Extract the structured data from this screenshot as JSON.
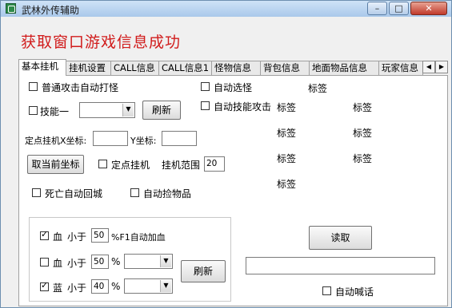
{
  "window": {
    "title": "武林外传辅助",
    "minimize": "–",
    "maximize": "□",
    "close": "✕"
  },
  "heading": "获取窗口游戏信息成功",
  "tabs": [
    "基本挂机",
    "挂机设置",
    "CALL信息",
    "CALL信息1",
    "怪物信息",
    "背包信息",
    "地面物品信息",
    "玩家信息"
  ],
  "tab_scroll": {
    "left": "◀",
    "right": "▶"
  },
  "basic": {
    "auto_attack": "普通攻击自动打怪",
    "auto_select": "自动选怪",
    "skill1": "技能一",
    "auto_skill": "自动技能攻击",
    "refresh1": "刷新",
    "fixed_x_label": "定点挂机X坐标:",
    "fixed_y_label": "Y坐标:",
    "get_coord": "取当前坐标",
    "fixed_hang": "定点挂机",
    "range_label": "挂机范围",
    "range_value": "20",
    "death_return": "死亡自动回城",
    "auto_pickup": "自动捡物品",
    "labels": [
      "标签",
      "标签",
      "标签",
      "标签",
      "标签",
      "标签",
      "标签",
      "标签"
    ]
  },
  "potion": {
    "hp1_check": "血",
    "hp1_less": "小于",
    "hp1_value": "50",
    "hp1_suffix": "%F1自动加血",
    "hp2_check": "血",
    "hp2_less": "小于",
    "hp2_value": "50",
    "hp2_pct": "%",
    "mp_check": "蓝",
    "mp_less": "小于",
    "mp_value": "40",
    "mp_pct": "%",
    "refresh2": "刷新"
  },
  "right": {
    "read": "读取",
    "auto_shout": "自动喊话",
    "shout_text": ""
  }
}
